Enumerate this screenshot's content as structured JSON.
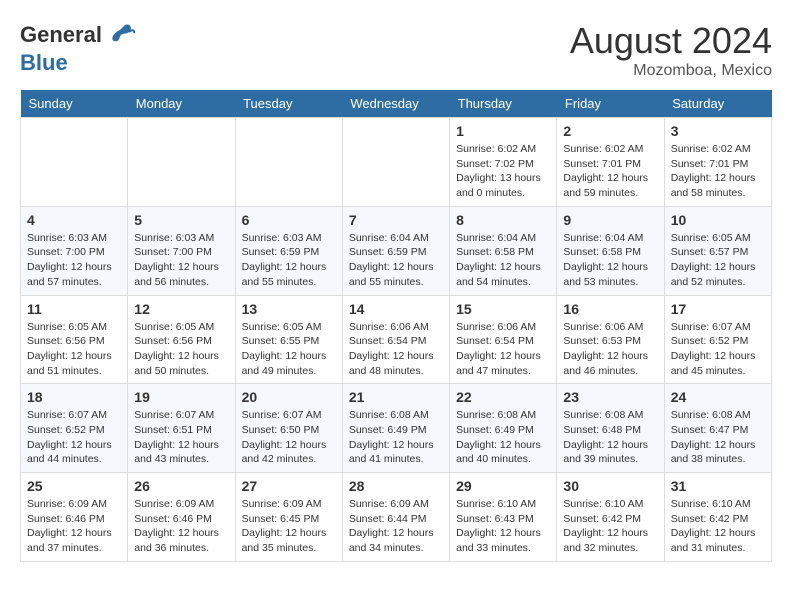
{
  "header": {
    "logo_line1": "General",
    "logo_line2": "Blue",
    "month_year": "August 2024",
    "location": "Mozomboa, Mexico"
  },
  "weekdays": [
    "Sunday",
    "Monday",
    "Tuesday",
    "Wednesday",
    "Thursday",
    "Friday",
    "Saturday"
  ],
  "weeks": [
    [
      {
        "day": "",
        "empty": true
      },
      {
        "day": "",
        "empty": true
      },
      {
        "day": "",
        "empty": true
      },
      {
        "day": "",
        "empty": true
      },
      {
        "day": "1",
        "sunrise": "6:02 AM",
        "sunset": "7:02 PM",
        "daylight": "13 hours and 0 minutes."
      },
      {
        "day": "2",
        "sunrise": "6:02 AM",
        "sunset": "7:01 PM",
        "daylight": "12 hours and 59 minutes."
      },
      {
        "day": "3",
        "sunrise": "6:02 AM",
        "sunset": "7:01 PM",
        "daylight": "12 hours and 58 minutes."
      }
    ],
    [
      {
        "day": "4",
        "sunrise": "6:03 AM",
        "sunset": "7:00 PM",
        "daylight": "12 hours and 57 minutes."
      },
      {
        "day": "5",
        "sunrise": "6:03 AM",
        "sunset": "7:00 PM",
        "daylight": "12 hours and 56 minutes."
      },
      {
        "day": "6",
        "sunrise": "6:03 AM",
        "sunset": "6:59 PM",
        "daylight": "12 hours and 55 minutes."
      },
      {
        "day": "7",
        "sunrise": "6:04 AM",
        "sunset": "6:59 PM",
        "daylight": "12 hours and 55 minutes."
      },
      {
        "day": "8",
        "sunrise": "6:04 AM",
        "sunset": "6:58 PM",
        "daylight": "12 hours and 54 minutes."
      },
      {
        "day": "9",
        "sunrise": "6:04 AM",
        "sunset": "6:58 PM",
        "daylight": "12 hours and 53 minutes."
      },
      {
        "day": "10",
        "sunrise": "6:05 AM",
        "sunset": "6:57 PM",
        "daylight": "12 hours and 52 minutes."
      }
    ],
    [
      {
        "day": "11",
        "sunrise": "6:05 AM",
        "sunset": "6:56 PM",
        "daylight": "12 hours and 51 minutes."
      },
      {
        "day": "12",
        "sunrise": "6:05 AM",
        "sunset": "6:56 PM",
        "daylight": "12 hours and 50 minutes."
      },
      {
        "day": "13",
        "sunrise": "6:05 AM",
        "sunset": "6:55 PM",
        "daylight": "12 hours and 49 minutes."
      },
      {
        "day": "14",
        "sunrise": "6:06 AM",
        "sunset": "6:54 PM",
        "daylight": "12 hours and 48 minutes."
      },
      {
        "day": "15",
        "sunrise": "6:06 AM",
        "sunset": "6:54 PM",
        "daylight": "12 hours and 47 minutes."
      },
      {
        "day": "16",
        "sunrise": "6:06 AM",
        "sunset": "6:53 PM",
        "daylight": "12 hours and 46 minutes."
      },
      {
        "day": "17",
        "sunrise": "6:07 AM",
        "sunset": "6:52 PM",
        "daylight": "12 hours and 45 minutes."
      }
    ],
    [
      {
        "day": "18",
        "sunrise": "6:07 AM",
        "sunset": "6:52 PM",
        "daylight": "12 hours and 44 minutes."
      },
      {
        "day": "19",
        "sunrise": "6:07 AM",
        "sunset": "6:51 PM",
        "daylight": "12 hours and 43 minutes."
      },
      {
        "day": "20",
        "sunrise": "6:07 AM",
        "sunset": "6:50 PM",
        "daylight": "12 hours and 42 minutes."
      },
      {
        "day": "21",
        "sunrise": "6:08 AM",
        "sunset": "6:49 PM",
        "daylight": "12 hours and 41 minutes."
      },
      {
        "day": "22",
        "sunrise": "6:08 AM",
        "sunset": "6:49 PM",
        "daylight": "12 hours and 40 minutes."
      },
      {
        "day": "23",
        "sunrise": "6:08 AM",
        "sunset": "6:48 PM",
        "daylight": "12 hours and 39 minutes."
      },
      {
        "day": "24",
        "sunrise": "6:08 AM",
        "sunset": "6:47 PM",
        "daylight": "12 hours and 38 minutes."
      }
    ],
    [
      {
        "day": "25",
        "sunrise": "6:09 AM",
        "sunset": "6:46 PM",
        "daylight": "12 hours and 37 minutes."
      },
      {
        "day": "26",
        "sunrise": "6:09 AM",
        "sunset": "6:46 PM",
        "daylight": "12 hours and 36 minutes."
      },
      {
        "day": "27",
        "sunrise": "6:09 AM",
        "sunset": "6:45 PM",
        "daylight": "12 hours and 35 minutes."
      },
      {
        "day": "28",
        "sunrise": "6:09 AM",
        "sunset": "6:44 PM",
        "daylight": "12 hours and 34 minutes."
      },
      {
        "day": "29",
        "sunrise": "6:10 AM",
        "sunset": "6:43 PM",
        "daylight": "12 hours and 33 minutes."
      },
      {
        "day": "30",
        "sunrise": "6:10 AM",
        "sunset": "6:42 PM",
        "daylight": "12 hours and 32 minutes."
      },
      {
        "day": "31",
        "sunrise": "6:10 AM",
        "sunset": "6:42 PM",
        "daylight": "12 hours and 31 minutes."
      }
    ]
  ]
}
